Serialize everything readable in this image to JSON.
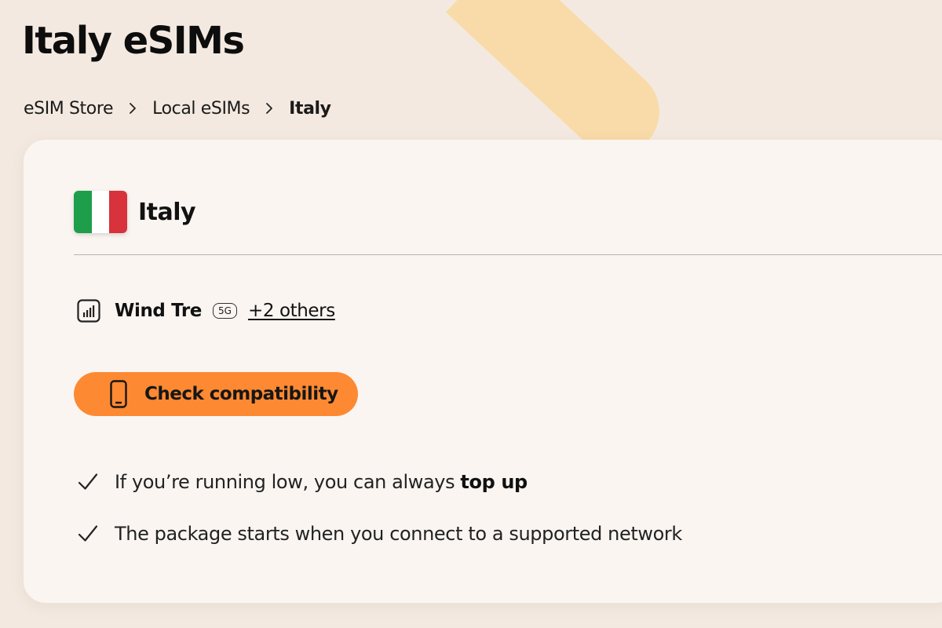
{
  "header": {
    "title": "Italy eSIMs"
  },
  "breadcrumb": {
    "items": [
      "eSIM Store",
      "Local eSIMs",
      "Italy"
    ]
  },
  "card": {
    "country": "Italy",
    "network": {
      "name": "Wind Tre",
      "badge": "5G",
      "others_link": "+2 others"
    },
    "compat_button": {
      "label": "Check compatibility"
    },
    "features": [
      {
        "text": "If you’re running low, you can always ",
        "emphasis": "top up"
      },
      {
        "text": "The package starts when you connect to a supported network",
        "emphasis": ""
      }
    ]
  },
  "colors": {
    "background": "#f3e9e0",
    "card": "#faf5f1",
    "accent": "#fd8932",
    "decoration": "#f8dba8"
  },
  "icons": {
    "network": "signal-bars-icon",
    "button": "phone-icon",
    "features": "checkmark-icon"
  }
}
